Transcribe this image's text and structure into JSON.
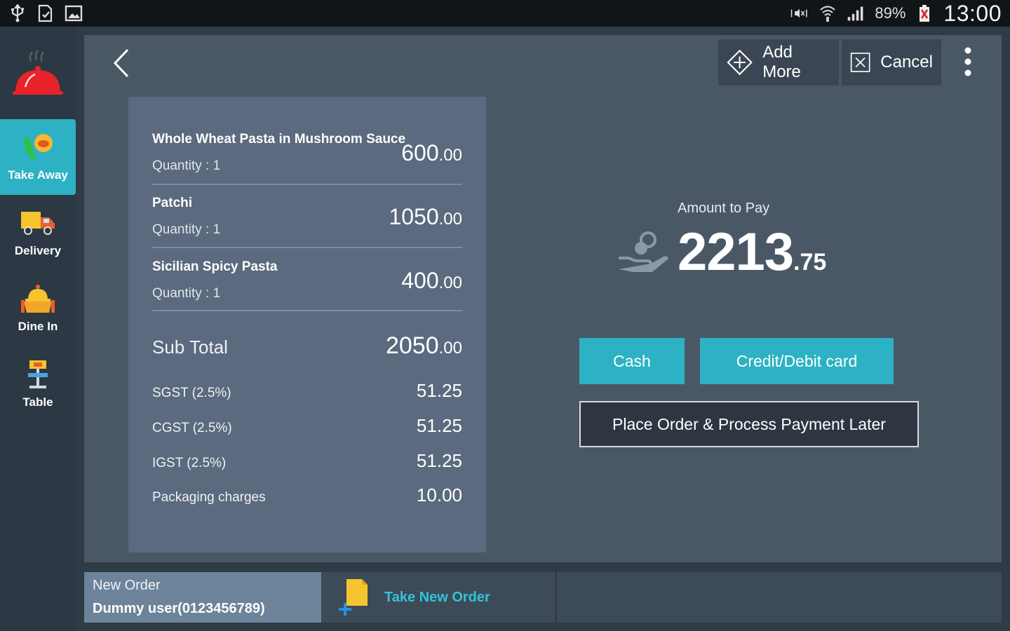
{
  "status_bar": {
    "left_icons": [
      "usb-icon",
      "file-check-icon",
      "image-icon"
    ],
    "right_icons": [
      "mute-icon",
      "wifi-icon",
      "signal-icon",
      "battery-icon"
    ],
    "battery": "89%",
    "time": "13:00"
  },
  "sidebar": {
    "logo_icon": "restaurant-bell-icon",
    "items": [
      {
        "label": "Take Away",
        "icon": "take-away-icon",
        "active": true
      },
      {
        "label": "Delivery",
        "icon": "delivery-truck-icon",
        "active": false
      },
      {
        "label": "Dine In",
        "icon": "dine-in-icon",
        "active": false
      },
      {
        "label": "Table",
        "icon": "table-icon",
        "active": false
      }
    ]
  },
  "toolbar": {
    "add_more_label": "Add More",
    "cancel_label": "Cancel"
  },
  "order": {
    "items": [
      {
        "name": "Whole Wheat Pasta in Mushroom Sauce",
        "quantity": "Quantity : 1",
        "price_int": "600",
        "price_dec": ".00"
      },
      {
        "name": "Patchi",
        "quantity": "Quantity : 1",
        "price_int": "1050",
        "price_dec": ".00"
      },
      {
        "name": "Sicilian Spicy Pasta",
        "quantity": "Quantity : 1",
        "price_int": "400",
        "price_dec": ".00"
      }
    ],
    "subtotal": {
      "label": "Sub Total",
      "value_int": "2050",
      "value_dec": ".00"
    },
    "charges": [
      {
        "label": "SGST (2.5%)",
        "value": "51.25"
      },
      {
        "label": "CGST (2.5%)",
        "value": "51.25"
      },
      {
        "label": "IGST (2.5%)",
        "value": "51.25"
      },
      {
        "label": "Packaging charges",
        "value": "10.00"
      }
    ]
  },
  "payment": {
    "amount_label": "Amount to Pay",
    "amount_int": "2213",
    "amount_dec": ".75",
    "cash_label": "Cash",
    "card_label": "Credit/Debit card",
    "later_label": "Place Order & Process Payment Later"
  },
  "bottom": {
    "order_title": "New Order",
    "order_user": "Dummy user(0123456789)",
    "new_order_label": "Take New Order"
  },
  "colors": {
    "accent": "#2cb2c4",
    "panel": "#4a5866",
    "card": "#5b6a7e",
    "logo": "#e8232c"
  }
}
